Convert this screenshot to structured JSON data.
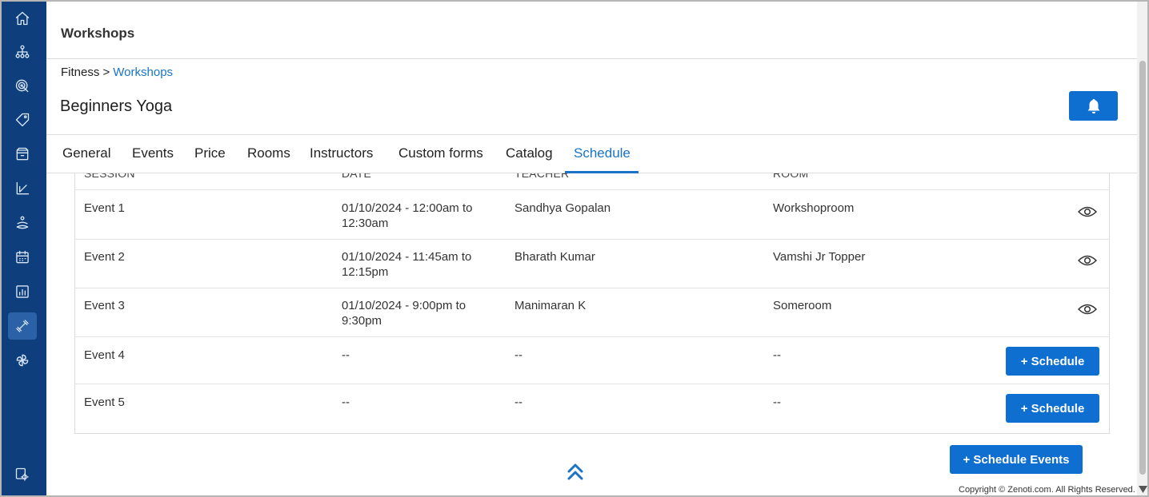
{
  "sidebar": {
    "items": [
      {
        "icon": "home-icon",
        "active": false
      },
      {
        "icon": "org-chart-icon",
        "active": false
      },
      {
        "icon": "target-icon",
        "active": false
      },
      {
        "icon": "tag-icon",
        "active": false
      },
      {
        "icon": "box-icon",
        "active": false
      },
      {
        "icon": "chart-icon",
        "active": false
      },
      {
        "icon": "wellness-icon",
        "active": false
      },
      {
        "icon": "calendar-icon",
        "active": false
      },
      {
        "icon": "report-icon",
        "active": false
      },
      {
        "icon": "dumbbell-icon",
        "active": true
      },
      {
        "icon": "pinwheel-icon",
        "active": false
      },
      {
        "icon": "settings-icon",
        "active": false
      }
    ]
  },
  "header": {
    "title": "Workshops"
  },
  "breadcrumb": {
    "parent": "Fitness >",
    "current": "Workshops"
  },
  "page_title": "Beginners Yoga",
  "tabs": [
    {
      "label": "General",
      "active": false
    },
    {
      "label": "Events",
      "active": false
    },
    {
      "label": "Price",
      "active": false
    },
    {
      "label": "Rooms",
      "active": false
    },
    {
      "label": "Instructors",
      "active": false
    },
    {
      "label": "Custom forms",
      "active": false
    },
    {
      "label": "Catalog",
      "active": false
    },
    {
      "label": "Schedule",
      "active": true
    }
  ],
  "table": {
    "headers": {
      "session": "SESSION",
      "date": "DATE",
      "teacher": "TEACHER",
      "room": "ROOM"
    },
    "rows": [
      {
        "session": "Event 1",
        "date": "01/10/2024 - 12:00am to",
        "date2": "12:30am",
        "teacher": "Sandhya Gopalan",
        "room": "Workshoproom",
        "action": "view"
      },
      {
        "session": "Event 2",
        "date": "01/10/2024 - 11:45am to",
        "date2": "12:15pm",
        "teacher": "Bharath Kumar",
        "room": "Vamshi Jr Topper",
        "action": "view"
      },
      {
        "session": "Event 3",
        "date": "01/10/2024 - 9:00pm to",
        "date2": "9:30pm",
        "teacher": "Manimaran K",
        "room": "Someroom",
        "action": "view"
      },
      {
        "session": "Event 4",
        "date": "--",
        "date2": "",
        "teacher": "--",
        "room": "--",
        "action": "+ Schedule"
      },
      {
        "session": "Event 5",
        "date": "--",
        "date2": "",
        "teacher": "--",
        "room": "--",
        "action": "+ Schedule"
      }
    ]
  },
  "schedule_events_label": "+ Schedule Events",
  "copyright": "Copyright © Zenoti.com. All Rights Reserved.",
  "colors": {
    "sidebar_bg": "#0e3f7c",
    "accent": "#0f6fd1",
    "link": "#1a73c6"
  }
}
